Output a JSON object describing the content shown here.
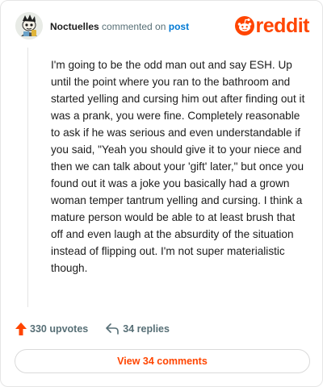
{
  "header": {
    "username": "Noctuelles",
    "action_text": "commented on",
    "post_link": "post",
    "logo_word": "reddit"
  },
  "comment": {
    "body": "I'm going to be the odd man out and say ESH. Up until the point where you ran to the bathroom and started yelling and cursing him out after finding out it was a prank, you were fine. Completely reasonable to ask if he was serious and even understandable if you said, \"Yeah you should give it to your niece and then we can talk about your 'gift' later,\" but once you found out it was a joke you basically had a grown woman temper tantrum yelling and cursing. I think a mature person would be able to at least brush that off and even laugh at the absurdity of the situation instead of flipping out. I'm not super materialistic though."
  },
  "footer": {
    "upvotes": "330 upvotes",
    "replies": "34 replies",
    "view_comments": "View 34 comments"
  },
  "colors": {
    "brand": "#ff4500",
    "link": "#0079d3",
    "muted": "#576f76"
  },
  "icons": {
    "avatar": "snoo-avatar",
    "logo": "reddit-snoo-icon",
    "upvote": "upvote-arrow-icon",
    "reply": "reply-arrow-icon"
  }
}
